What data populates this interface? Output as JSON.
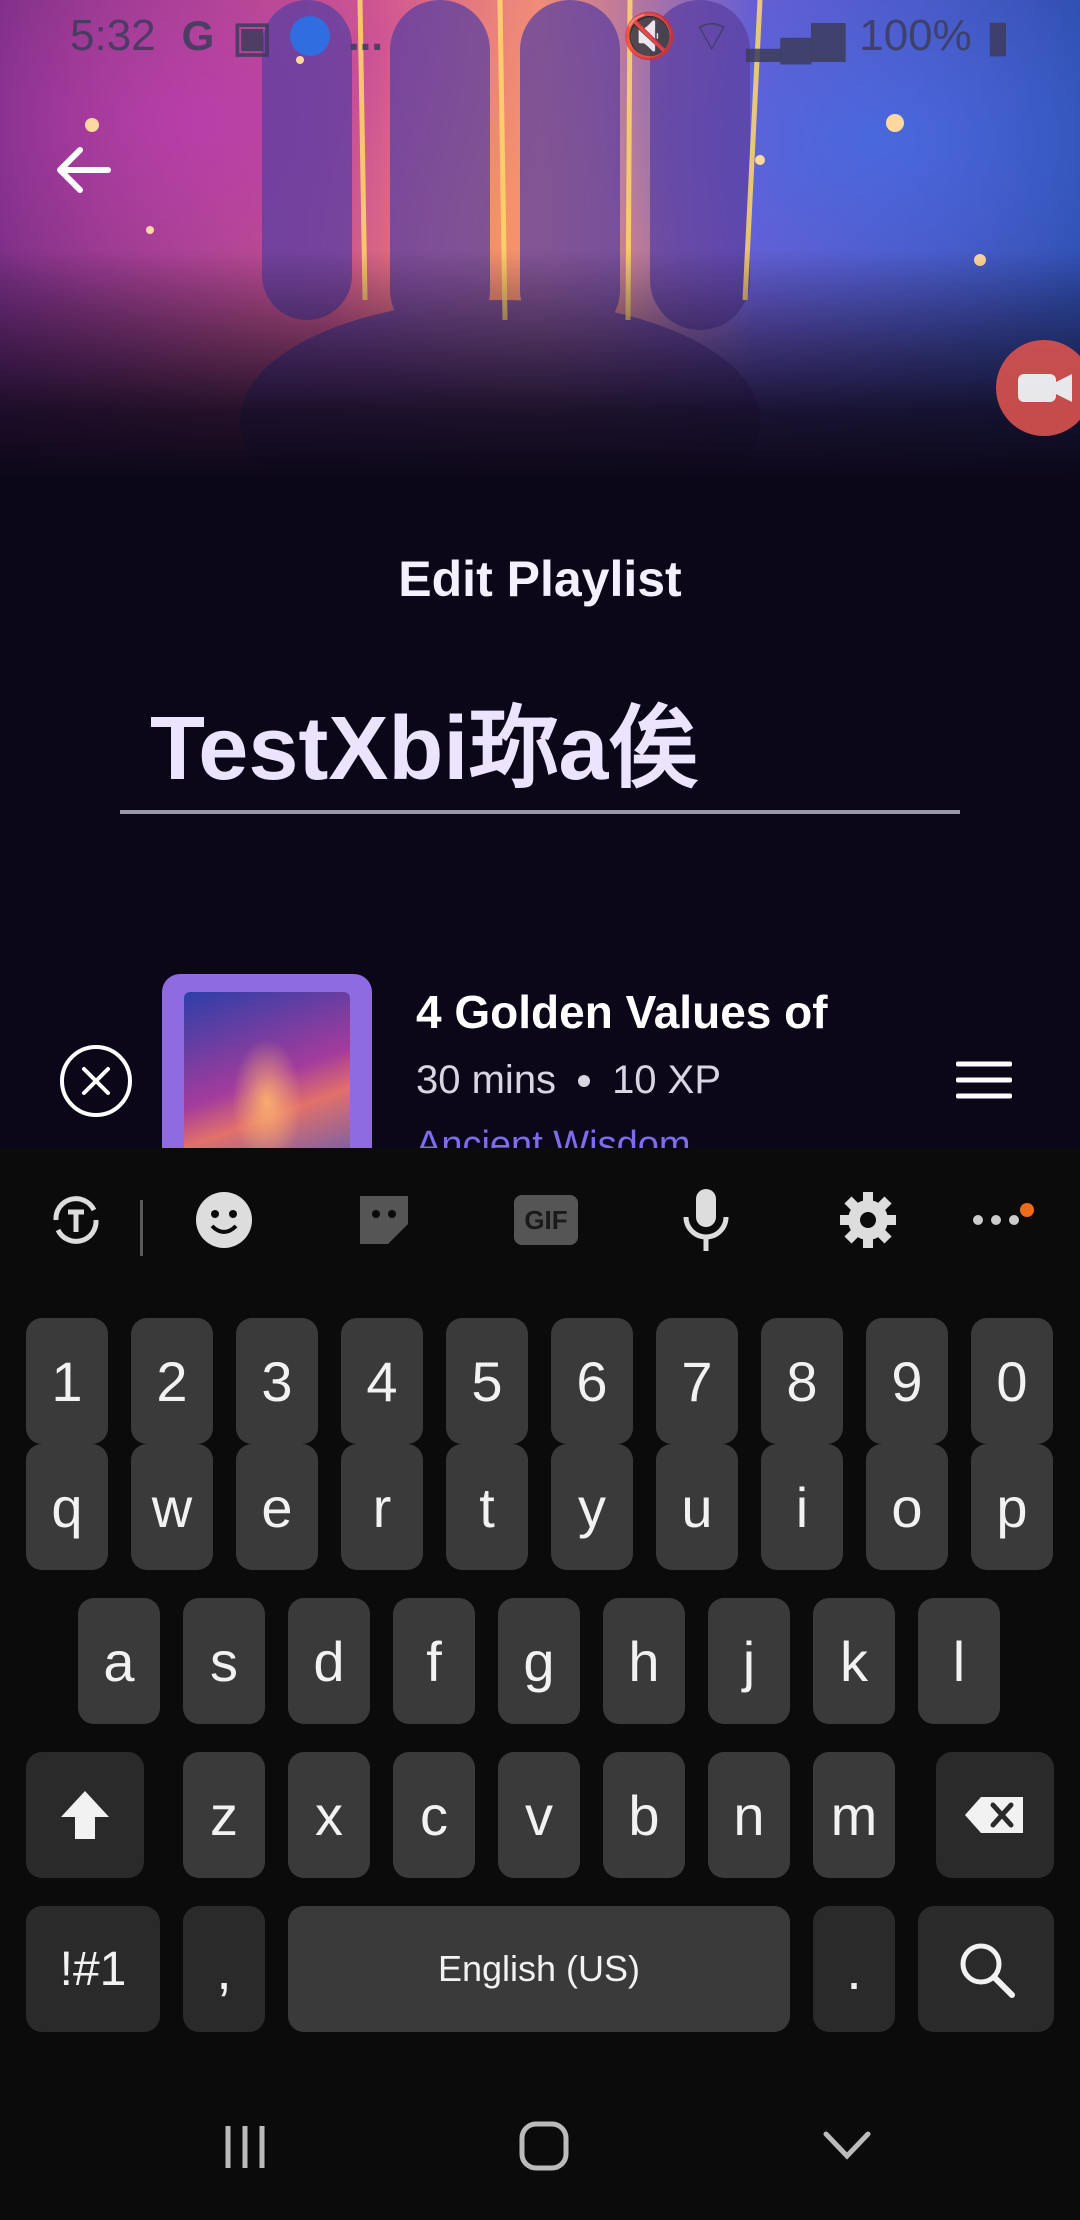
{
  "status_bar": {
    "time": "5:32",
    "left_icons": [
      "G",
      "teams-icon",
      "app-icon",
      "..."
    ],
    "battery": "100%"
  },
  "header": {
    "back_icon": "arrow-left-icon",
    "record_icon": "video-record-icon"
  },
  "page": {
    "title": "Edit Playlist",
    "name_value": "TestXbi珎a俟"
  },
  "playlist_item": {
    "title": "4 Golden Values of",
    "duration": "30 mins",
    "xp": "10 XP",
    "category": "Ancient Wisdom",
    "remove_icon": "close-circle-icon",
    "drag_icon": "drag-handle-icon"
  },
  "keyboard": {
    "toolbar": [
      "translate-icon",
      "emoji-icon",
      "sticker-icon",
      "gif-icon",
      "microphone-icon",
      "settings-icon",
      "more-icon"
    ],
    "gif_label": "GIF",
    "row_numbers": [
      "1",
      "2",
      "3",
      "4",
      "5",
      "6",
      "7",
      "8",
      "9",
      "0"
    ],
    "row_q": [
      "q",
      "w",
      "e",
      "r",
      "t",
      "y",
      "u",
      "i",
      "o",
      "p"
    ],
    "row_a": [
      "a",
      "s",
      "d",
      "f",
      "g",
      "h",
      "j",
      "k",
      "l"
    ],
    "row_z": [
      "z",
      "x",
      "c",
      "v",
      "b",
      "n",
      "m"
    ],
    "symbols_key": "!#1",
    "comma_key": ",",
    "space_label": "English (US)",
    "period_key": ".",
    "shift_icon": "shift-icon",
    "backspace_icon": "backspace-icon",
    "search_icon": "search-icon"
  },
  "nav_bar": [
    "recents-icon",
    "home-icon",
    "back-chevron-icon"
  ],
  "colors": {
    "background": "#0c0718",
    "accent_purple": "#8e6be0",
    "category_text": "#7d6cf0",
    "record_button": "#d9534f"
  }
}
